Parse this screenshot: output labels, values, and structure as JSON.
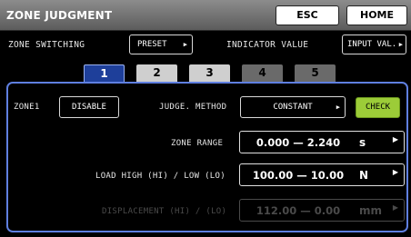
{
  "header": {
    "title": "ZONE JUDGMENT",
    "esc_label": "ESC",
    "home_label": "HOME"
  },
  "controls": {
    "zone_switching_label": "ZONE SWITCHING",
    "zone_switching_value": "PRESET",
    "indicator_value_label": "INDICATOR VALUE",
    "indicator_value_button": "INPUT VAL."
  },
  "tabs": [
    {
      "label": "1",
      "state": "active"
    },
    {
      "label": "2",
      "state": "light"
    },
    {
      "label": "3",
      "state": "light"
    },
    {
      "label": "4",
      "state": "dark"
    },
    {
      "label": "5",
      "state": "dark"
    }
  ],
  "zone": {
    "name_label": "ZONE1",
    "enable_button": "DISABLE",
    "judge_method_label": "JUDGE. METHOD",
    "judge_method_value": "CONSTANT",
    "check_label": "CHECK",
    "zone_range_label": "ZONE RANGE",
    "zone_range_value": "0.000 — 2.240",
    "zone_range_unit": "s",
    "load_label": "LOAD HIGH (HI) / LOW (LO)",
    "load_value": "100.00 — 10.00",
    "load_unit": "N",
    "displacement_label": "DISPLACEMENT (HI) / (LO)",
    "displacement_value": "112.00 — 0.00",
    "displacement_unit": "mm"
  },
  "colors": {
    "active_tab": "#1e3f9a",
    "panel_border": "#5f7fe0",
    "check_button": "#9ccc38"
  }
}
